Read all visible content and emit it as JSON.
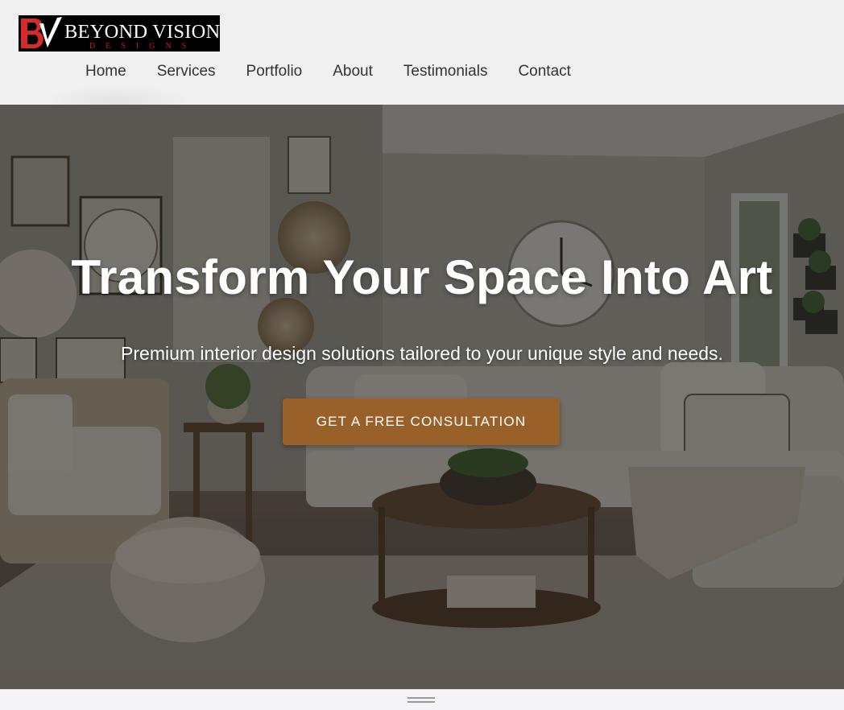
{
  "brand": {
    "monogram": "BV",
    "name": "BEYOND VISION",
    "tagline": "DESIGNS",
    "colors": {
      "mark_red": "#d62b2b",
      "background": "#000000",
      "tagline": "#c21d25"
    }
  },
  "nav": {
    "items": [
      {
        "label": "Home"
      },
      {
        "label": "Services"
      },
      {
        "label": "Portfolio"
      },
      {
        "label": "About"
      },
      {
        "label": "Testimonials"
      },
      {
        "label": "Contact"
      }
    ]
  },
  "hero": {
    "title": "Transform Your Space Into Art",
    "subtitle": "Premium interior design solutions tailored to your unique style and needs.",
    "cta_label": "GET A FREE CONSULTATION",
    "background_image": "living-room-interior",
    "colors": {
      "cta": "#9a6029",
      "overlay": "rgba(0,0,0,0.45)"
    }
  },
  "bottom_bar": {
    "handle_icon": "drag-handle-icon"
  }
}
